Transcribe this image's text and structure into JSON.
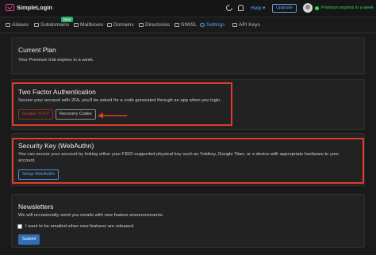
{
  "app": {
    "name": "SimpleLogin"
  },
  "topbar": {
    "help_label": "Help ▾",
    "upgrade_label": "Upgrade",
    "premium_text": "Premium expires in a week"
  },
  "nav": {
    "items": [
      {
        "label": "Aliases"
      },
      {
        "label": "Subdomains"
      },
      {
        "label": "Mailboxes"
      },
      {
        "label": "Domains"
      },
      {
        "label": "Directories"
      },
      {
        "label": "SIWSL"
      },
      {
        "label": "Settings"
      },
      {
        "label": "API Keys"
      }
    ],
    "new_badge": "New"
  },
  "current_plan": {
    "title": "Current Plan",
    "text": "Your Premium trial expires in a week."
  },
  "two_factor": {
    "title": "Two Factor Authentication",
    "text": "Secure your account with 2FA, you'll be asked for a code generated through an app when you login.",
    "disable_label": "Disable TOTP",
    "recovery_label": "Recovery Codes"
  },
  "security_key": {
    "title": "Security Key (WebAuthn)",
    "text_line1": "You can secure your account by linking either your FIDO-supported physical key such as Yubikey, Google Titan, or a device with appropriate hardware to your",
    "text_line2": "account.",
    "setup_label": "Setup WebAuthn"
  },
  "newsletters": {
    "title": "Newsletters",
    "text": "We will occasionally send you emails with new feature announcements.",
    "checkbox_label": "I want to be emailed when new features are released.",
    "submit_label": "Submit"
  },
  "colors": {
    "accent": "#5aa0e6",
    "highlight": "#e53a2a",
    "premium": "#3bd16f",
    "badge": "#2fb06b"
  }
}
